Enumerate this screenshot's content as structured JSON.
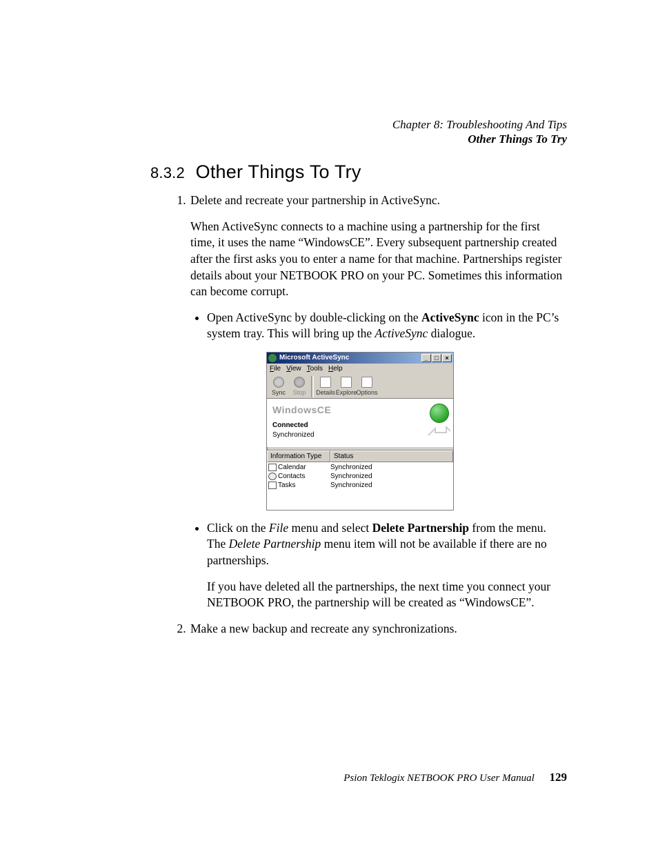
{
  "header": {
    "chapter": "Chapter 8:  Troubleshooting And Tips",
    "section_title": "Other Things To Try"
  },
  "heading": {
    "number": "8.3.2",
    "title": "Other Things To Try"
  },
  "content": {
    "step1_lead": "Delete and recreate your partnership in ActiveSync.",
    "step1_para": "When ActiveSync connects to a machine using a partnership for the first time, it uses the name “WindowsCE”. Every subsequent partnership created after the first asks you to enter a name for that machine. Partnerships register details about your NETBOOK PRO on your PC. Sometimes this information can become corrupt.",
    "bullet1_a": "Open ActiveSync by double-clicking on the ",
    "bullet1_b": "ActiveSync",
    "bullet1_c": " icon in the PC’s system tray. This will bring up the ",
    "bullet1_d": "ActiveSync",
    "bullet1_e": " dialogue.",
    "bullet2_a": "Click on the ",
    "bullet2_b": "File",
    "bullet2_c": " menu and select ",
    "bullet2_d": "Delete Partnership",
    "bullet2_e": " from the menu. The ",
    "bullet2_f": "Delete Partnership",
    "bullet2_g": " menu item will not be available if there are no partnerships.",
    "bullet2_para": "If you have deleted all the partnerships, the next time you connect your NETBOOK PRO, the partnership will be created as “WindowsCE”.",
    "step2": "Make a new backup and recreate any synchronizations."
  },
  "dialog": {
    "title": "Microsoft ActiveSync",
    "menus": [
      "File",
      "View",
      "Tools",
      "Help"
    ],
    "toolbar": [
      {
        "label": "Sync",
        "icon": "sync",
        "disabled": false
      },
      {
        "label": "Stop",
        "icon": "stop",
        "disabled": true
      },
      {
        "label": "Details",
        "icon": "doc",
        "disabled": false
      },
      {
        "label": "Explore",
        "icon": "mag",
        "disabled": false
      },
      {
        "label": "Options",
        "icon": "opt",
        "disabled": false
      }
    ],
    "device_name": "WindowsCE",
    "conn_state": "Connected",
    "sync_state": "Synchronized",
    "columns": [
      "Information Type",
      "Status"
    ],
    "rows": [
      {
        "icon": "cal",
        "type": "Calendar",
        "status": "Synchronized"
      },
      {
        "icon": "con",
        "type": "Contacts",
        "status": "Synchronized"
      },
      {
        "icon": "tsk",
        "type": "Tasks",
        "status": "Synchronized"
      }
    ]
  },
  "footer": {
    "manual": "Psion Teklogix NETBOOK PRO User Manual",
    "page": "129"
  }
}
